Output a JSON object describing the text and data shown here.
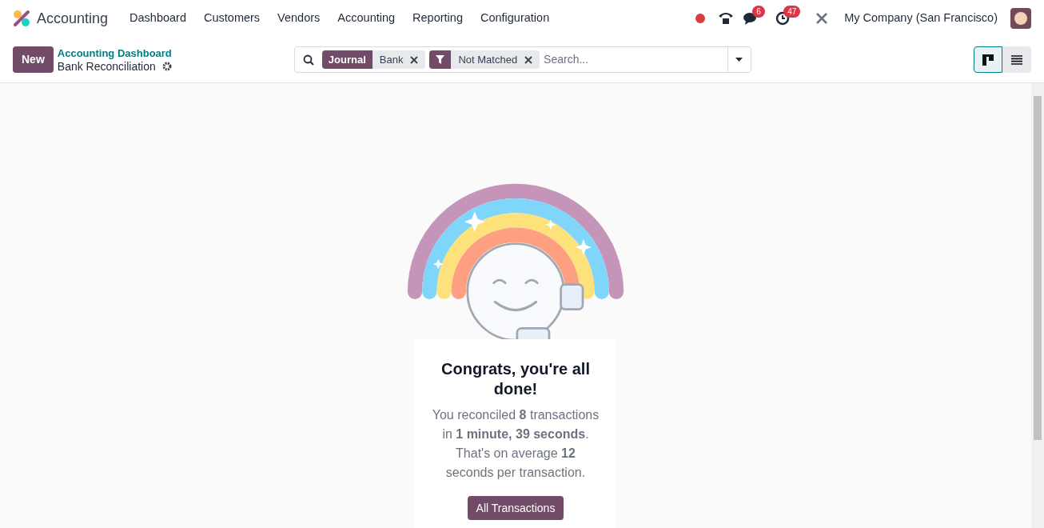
{
  "navbar": {
    "app_name": "Accounting",
    "menu": [
      "Dashboard",
      "Customers",
      "Vendors",
      "Accounting",
      "Reporting",
      "Configuration"
    ],
    "messages_badge": "6",
    "activities_badge": "47",
    "company": "My Company (San Francisco)"
  },
  "control_panel": {
    "new_button": "New",
    "breadcrumb_parent": "Accounting Dashboard",
    "breadcrumb_current": "Bank Reconciliation",
    "facets": [
      {
        "kind": "group",
        "label": "Journal",
        "value": "Bank"
      },
      {
        "kind": "filter",
        "value": "Not Matched"
      }
    ],
    "search_placeholder": "Search...",
    "views": [
      {
        "kind": "kanban",
        "selected": true
      },
      {
        "kind": "list",
        "selected": false
      }
    ]
  },
  "done_card": {
    "title": "Congrats, you're all done!",
    "message": "You reconciled **8** transactions in **1 minute, 39 seconds**. That's on average **12** seconds per transaction.",
    "button": "All Transactions"
  }
}
